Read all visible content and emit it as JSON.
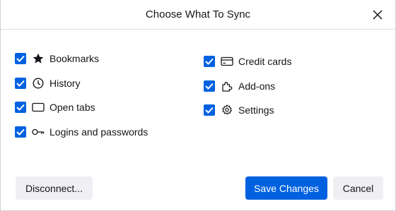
{
  "dialog": {
    "title": "Choose What To Sync",
    "close_icon": "close-icon"
  },
  "options_left": [
    {
      "label": "Bookmarks",
      "icon": "star-icon",
      "checked": true
    },
    {
      "label": "History",
      "icon": "clock-icon",
      "checked": true
    },
    {
      "label": "Open tabs",
      "icon": "tab-icon",
      "checked": true
    },
    {
      "label": "Logins and passwords",
      "icon": "key-icon",
      "checked": true
    }
  ],
  "options_right": [
    {
      "label": "Credit cards",
      "icon": "credit-card-icon",
      "checked": true
    },
    {
      "label": "Add-ons",
      "icon": "puzzle-icon",
      "checked": true
    },
    {
      "label": "Settings",
      "icon": "gear-icon",
      "checked": true
    }
  ],
  "buttons": {
    "disconnect": "Disconnect...",
    "save": "Save Changes",
    "cancel": "Cancel"
  },
  "colors": {
    "accent": "#0061e0",
    "button_secondary": "#f0f0f4",
    "text": "#15141a"
  }
}
